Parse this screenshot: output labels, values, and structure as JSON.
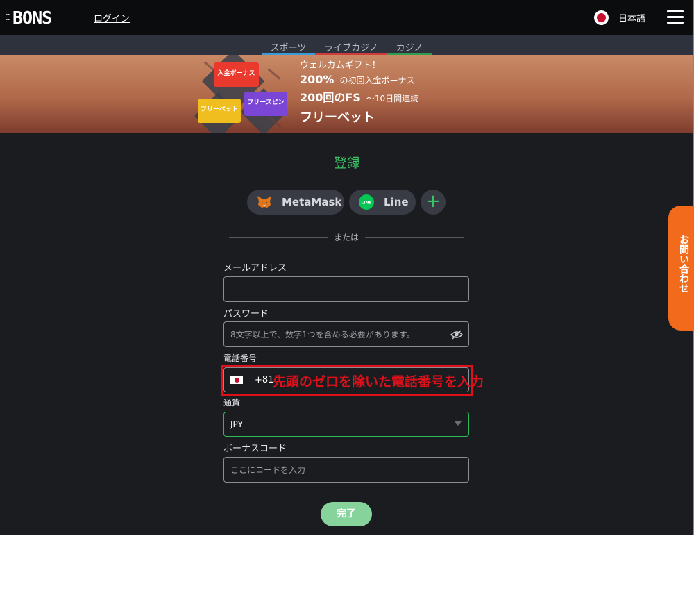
{
  "header": {
    "logo": "BONS",
    "login": "ログイン",
    "language": "日本語"
  },
  "subnav": [
    {
      "label": "スポーツ",
      "color": "#3a9bd9"
    },
    {
      "label": "ライブカジノ",
      "color": "#d13a3a"
    },
    {
      "label": "カジノ",
      "color": "#2f9e4f"
    }
  ],
  "banner": {
    "tags": [
      "入金ボーナス",
      "フリーベット",
      "フリースピン"
    ],
    "welcome": "ウェルカムギフト！",
    "bonus_pct": "200%",
    "bonus_text": "の初回入金ボーナス",
    "fs": "200回のFS",
    "fs_days": "～10日間連続",
    "freebet": "フリーベット"
  },
  "form": {
    "title": "登録",
    "social": [
      "MetaMask",
      "Line"
    ],
    "or": "または",
    "email_label": "メールアドレス",
    "email_value": "",
    "password_label": "パスワード",
    "password_placeholder": "8文字以上で、数字1つを含める必要があります。",
    "phone_label": "電話番号",
    "phone_code": "+81",
    "currency_label": "通貨",
    "currency_value": "JPY",
    "bonus_label": "ボーナスコード",
    "bonus_placeholder": "ここにコードを入力",
    "submit": "完了"
  },
  "annotation": "先頭のゼロを除いた電話番号を入力",
  "contact": "お問い合わせ",
  "colors": {
    "accent_green": "#3cc266",
    "annotation_red": "#e0101a",
    "contact_orange": "#f26b1d"
  }
}
